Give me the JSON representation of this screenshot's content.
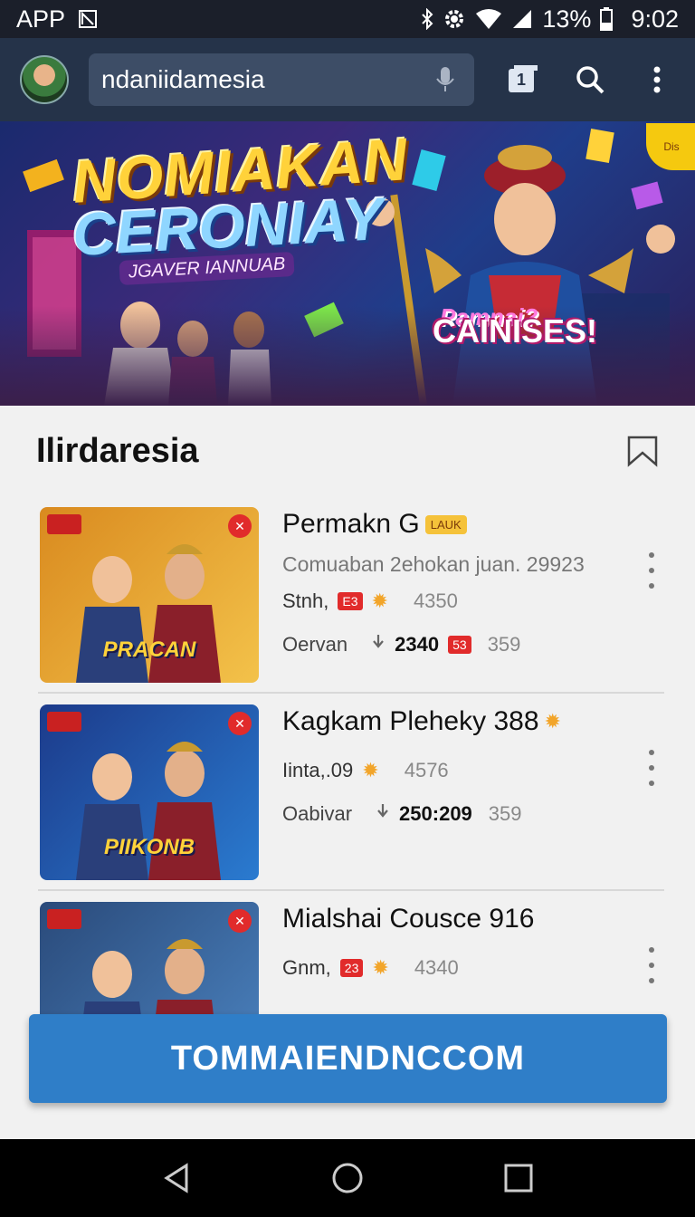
{
  "status_bar": {
    "app_label": "APP",
    "battery": "13%",
    "time": "9:02"
  },
  "app_bar": {
    "search_value": "ndaniidamesia",
    "tab_count": "1"
  },
  "hero": {
    "title_line1": "NOMIAKAN",
    "title_line2": "CERONIAY",
    "subtitle": "JGAVER IANNUAB",
    "badge_top": "Pamnai?",
    "badge": "CAINISES!",
    "corner_text": "Dis"
  },
  "section": {
    "title": "Ilirdaresia"
  },
  "games": [
    {
      "title": "Permakn G",
      "tag": "LAUK",
      "subtitle": "Comuaban 2ehokan juan. 29923",
      "meta_label": "Stnh,",
      "meta_badge": "E3",
      "meta_count": "4350",
      "stats_label": "Oervan",
      "stats_value": "2340",
      "stats_badge": "53",
      "stats_count": "359",
      "thumb_title": "PRACAN",
      "thumb_colors": [
        "#d98a1f",
        "#f3c24a"
      ]
    },
    {
      "title": "Kagkam Pleheky 388",
      "tag": "",
      "subtitle": "",
      "meta_label": "Iinta,.09",
      "meta_badge": "",
      "meta_count": "4576",
      "stats_label": "Oabivar",
      "stats_value": "250:209",
      "stats_badge": "",
      "stats_count": "359",
      "thumb_title": "PIIKONB",
      "thumb_colors": [
        "#1c3a8a",
        "#2a7bd0"
      ]
    },
    {
      "title": "Mialshai Cousce 916",
      "tag": "",
      "subtitle": "",
      "meta_label": "Gnm,",
      "meta_badge": "23",
      "meta_count": "4340",
      "stats_label": "",
      "stats_value": "",
      "stats_badge": "",
      "stats_count": "",
      "thumb_title": "",
      "thumb_colors": [
        "#2a4a7a",
        "#4b83c0"
      ]
    }
  ],
  "cta": {
    "label": "TOMMAIENDNCCOM"
  },
  "colors": {
    "app_bar": "#253349",
    "status_bar": "#1b1f2a",
    "cta": "#2f7ec8",
    "star": "#f2a52a",
    "badge_red": "#e12b2b"
  },
  "icons": [
    "mic-icon",
    "tabs-icon",
    "search-icon",
    "more-vert-icon",
    "bookmark-icon",
    "back-icon",
    "home-icon",
    "recents-icon",
    "wifi-icon",
    "signal-icon",
    "battery-icon",
    "bluetooth-icon",
    "settings-icon"
  ]
}
